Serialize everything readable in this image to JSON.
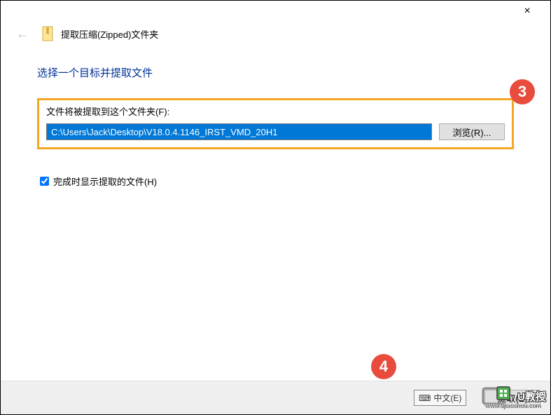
{
  "window": {
    "close_symbol": "×"
  },
  "header": {
    "back_arrow": "←",
    "title": "提取压缩(Zipped)文件夹"
  },
  "content": {
    "instruction": "选择一个目标并提取文件",
    "field_label": "文件将被提取到这个文件夹(F):",
    "path_value": "C:\\Users\\Jack\\Desktop\\V18.0.4.1146_IRST_VMD_20H1",
    "browse_label": "浏览(R)...",
    "checkbox_label": "完成时显示提取的文件(H)",
    "checkbox_checked": true
  },
  "footer": {
    "extract_label": "提取(E)"
  },
  "annotations": {
    "badge3": "3",
    "badge4": "4"
  },
  "watermark": {
    "text": "U教授",
    "url": "www.ujiaoshou.com"
  },
  "ime": {
    "label": "中文(E)"
  }
}
